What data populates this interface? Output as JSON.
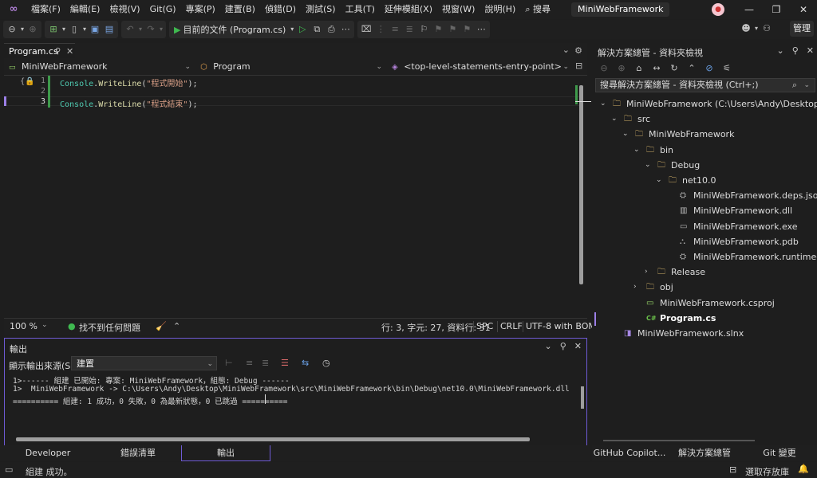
{
  "menubar": {
    "items": [
      "檔案(F)",
      "編輯(E)",
      "檢視(V)",
      "Git(G)",
      "專案(P)",
      "建置(B)",
      "偵錯(D)",
      "測試(S)",
      "工具(T)",
      "延伸模組(X)",
      "視窗(W)",
      "說明(H)"
    ],
    "search_label": "搜尋",
    "solution_name": "MiniWebFramework"
  },
  "toolbar": {
    "run_label": "目前的文件 (Program.cs)",
    "manage_label": "管理"
  },
  "editor": {
    "tab_label": "Program.cs",
    "nav_project": "MiniWebFramework",
    "nav_class": "Program",
    "nav_member": "<top-level-statements-entry-point>",
    "lines": [
      {
        "num": "1",
        "ident": "Console",
        "fn": "WriteLine",
        "str": "\"程式開始\"",
        "end": ");"
      },
      {
        "num": "2",
        "ident": "",
        "fn": "",
        "str": "",
        "end": ""
      },
      {
        "num": "3",
        "ident": "Console",
        "fn": "WriteLine",
        "str": "\"程式結束\"",
        "end": ");"
      }
    ],
    "status": {
      "zoom": "100 %",
      "issues": "找不到任何問題",
      "position": "行: 3, 字元: 27, 資料行: 31",
      "whitespace": "SPC",
      "line_ending": "CRLF",
      "encoding": "UTF-8 with BOM"
    }
  },
  "output": {
    "title": "輸出",
    "source_label": "顯示輸出來源(S):",
    "source_value": "建置",
    "lines": [
      "1>------ 組建 已開始: 專案: MiniWebFramework，組態: Debug ------",
      "1>  MiniWebFramework -> C:\\Users\\Andy\\Desktop\\MiniWebFramework\\src\\MiniWebFramework\\bin\\Debug\\net10.0\\MiniWebFramework.dll",
      "========== 組建: 1 成功，0 失敗，0 為最新狀態，0 已跳過 =========="
    ]
  },
  "bottom_tabs": [
    "Developer PowerShell",
    "錯誤清單",
    "輸出"
  ],
  "solution_explorer": {
    "title": "解決方案總管 - 資料夾檢視",
    "search_placeholder": "搜尋解決方案總管 - 資料夾檢視 (Ctrl+;)",
    "tree": [
      {
        "label": "MiniWebFramework (C:\\Users\\Andy\\Desktop\\MiniWebFramework)",
        "depth": 0,
        "twisty": "open",
        "icon": "folder"
      },
      {
        "label": "src",
        "depth": 1,
        "twisty": "open",
        "icon": "folder"
      },
      {
        "label": "MiniWebFramework",
        "depth": 2,
        "twisty": "open",
        "icon": "folder"
      },
      {
        "label": "bin",
        "depth": 3,
        "twisty": "open",
        "icon": "folder"
      },
      {
        "label": "Debug",
        "depth": 4,
        "twisty": "open",
        "icon": "folder"
      },
      {
        "label": "net10.0",
        "depth": 5,
        "twisty": "open",
        "icon": "folder"
      },
      {
        "label": "MiniWebFramework.deps.json",
        "depth": 6,
        "twisty": "none",
        "icon": "json"
      },
      {
        "label": "MiniWebFramework.dll",
        "depth": 6,
        "twisty": "none",
        "icon": "dll"
      },
      {
        "label": "MiniWebFramework.exe",
        "depth": 6,
        "twisty": "none",
        "icon": "exe"
      },
      {
        "label": "MiniWebFramework.pdb",
        "depth": 6,
        "twisty": "none",
        "icon": "pdb"
      },
      {
        "label": "MiniWebFramework.runtimeconfig.json",
        "depth": 6,
        "twisty": "none",
        "icon": "json"
      },
      {
        "label": "Release",
        "depth": 4,
        "twisty": "closed",
        "icon": "folder"
      },
      {
        "label": "obj",
        "depth": 3,
        "twisty": "closed",
        "icon": "folder"
      },
      {
        "label": "MiniWebFramework.csproj",
        "depth": 3,
        "twisty": "none",
        "icon": "csproj"
      },
      {
        "label": "Program.cs",
        "depth": 3,
        "twisty": "none",
        "icon": "cs",
        "selected": true
      },
      {
        "label": "MiniWebFramework.slnx",
        "depth": 1,
        "twisty": "none",
        "icon": "sln"
      }
    ],
    "tabs": [
      "GitHub Copilot...",
      "解決方案總管",
      "Git 變更"
    ]
  },
  "statusbar": {
    "message": "組建 成功。",
    "repo_label": "選取存放庫"
  }
}
